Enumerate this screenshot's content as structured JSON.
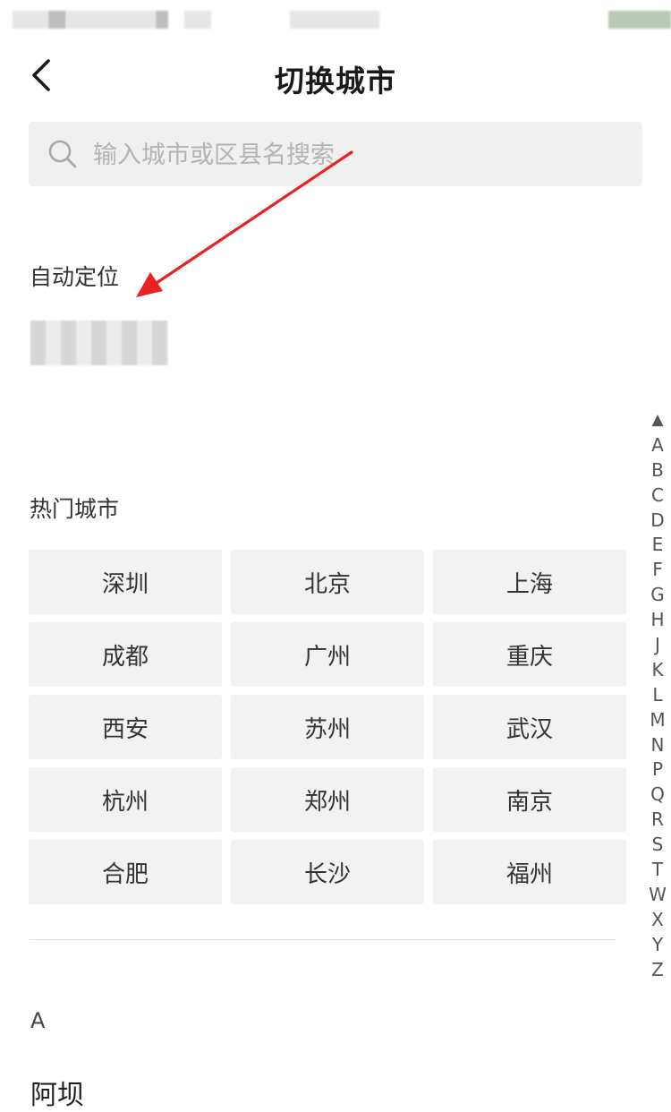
{
  "header": {
    "title": "切换城市",
    "back_icon": "chevron-left-icon"
  },
  "search": {
    "placeholder": "输入城市或区县名搜索",
    "value": "",
    "icon": "search-icon"
  },
  "auto_location": {
    "title": "自动定位"
  },
  "hot_cities": {
    "title": "热门城市",
    "cities": [
      "深圳",
      "北京",
      "上海",
      "成都",
      "广州",
      "重庆",
      "西安",
      "苏州",
      "武汉",
      "杭州",
      "郑州",
      "南京",
      "合肥",
      "长沙",
      "福州"
    ]
  },
  "city_list": {
    "letter": "A",
    "cities": [
      "阿坝"
    ]
  },
  "index_bar": [
    "▲",
    "A",
    "B",
    "C",
    "D",
    "E",
    "F",
    "G",
    "H",
    "J",
    "K",
    "L",
    "M",
    "N",
    "P",
    "Q",
    "R",
    "S",
    "T",
    "W",
    "X",
    "Y",
    "Z"
  ],
  "colors": {
    "annotation_arrow": "#e8231f",
    "button_bg": "#f2f2f2",
    "search_bg": "#f0f0f0"
  }
}
